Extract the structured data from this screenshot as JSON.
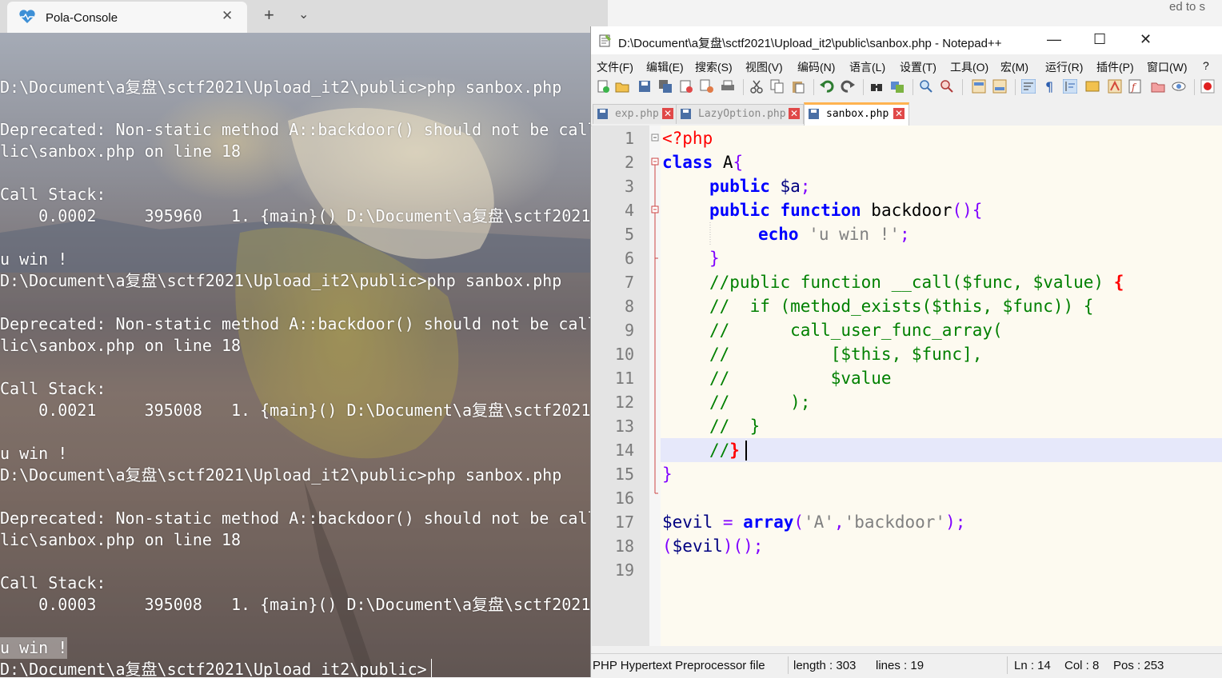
{
  "terminal": {
    "tab_title": "Pola-Console",
    "close_glyph": "✕",
    "new_tab_glyph": "+",
    "dropdown_glyph": "⌄",
    "lines": [
      "D:\\Document\\a复盘\\sctf2021\\Upload_it2\\public>php sanbox.php",
      "Deprecated: Non-static method A::backdoor() should not be call",
      "lic\\sanbox.php on line 18",
      "Call Stack:",
      "    0.0002     395960   1. {main}() D:\\Document\\a复盘\\sctf2021",
      "u win !",
      "D:\\Document\\a复盘\\sctf2021\\Upload_it2\\public>php sanbox.php",
      "Deprecated: Non-static method A::backdoor() should not be call",
      "lic\\sanbox.php on line 18",
      "Call Stack:",
      "    0.0021     395008   1. {main}() D:\\Document\\a复盘\\sctf2021",
      "u win !",
      "D:\\Document\\a复盘\\sctf2021\\Upload_it2\\public>php sanbox.php",
      "Deprecated: Non-static method A::backdoor() should not be call",
      "lic\\sanbox.php on line 18",
      "Call Stack:",
      "    0.0003     395008   1. {main}() D:\\Document\\a复盘\\sctf2021",
      "u win !",
      "D:\\Document\\a复盘\\sctf2021\\Upload_it2\\public>"
    ]
  },
  "notepad": {
    "title": "D:\\Document\\a复盘\\sctf2021\\Upload_it2\\public\\sanbox.php - Notepad++",
    "window_controls": {
      "minimize": "—",
      "maximize": "☐",
      "close": "✕"
    },
    "background_text": "ed to s",
    "menu": [
      "文件(F)",
      "编辑(E)",
      "搜索(S)",
      "视图(V)",
      "编码(N)",
      "语言(L)",
      "设置(T)",
      "工具(O)",
      "宏(M)",
      "运行(R)",
      "插件(P)",
      "窗口(W)",
      "?"
    ],
    "tabs": [
      {
        "label": "exp.php",
        "active": false
      },
      {
        "label": "LazyOption.php",
        "active": false
      },
      {
        "label": "sanbox.php",
        "active": true
      }
    ],
    "tab_close_glyph": "✕",
    "line_numbers": [
      "1",
      "2",
      "3",
      "4",
      "5",
      "6",
      "7",
      "8",
      "9",
      "10",
      "11",
      "12",
      "13",
      "14",
      "15",
      "16",
      "17",
      "18",
      "19"
    ],
    "code": {
      "l1": "<?php",
      "l2_kw": "class",
      "l2_name": " A",
      "l2_brace": "{",
      "l3_kw": "public",
      "l3_var": " $a",
      "l3_semi": ";",
      "l4_kw": "public function",
      "l4_name": " backdoor",
      "l4_paren": "(){",
      "l5_kw": "echo",
      "l5_str": " 'u win !'",
      "l5_semi": ";",
      "l6": "}",
      "l7_cm": "//public function __call($func, $value) ",
      "l7_brace": "{",
      "l8": "//  if (method_exists($this, $func)) {",
      "l9": "//      call_user_func_array(",
      "l10": "//          [$this, $func],",
      "l11": "//          $value",
      "l12": "//      );",
      "l13": "//  }",
      "l14_cm": "//",
      "l14_brace": "}",
      "l15": "}",
      "l17_var": "$evil",
      "l17_eq": " = ",
      "l17_kw": "array",
      "l17_p1": "(",
      "l17_s1": "'A'",
      "l17_comma": ",",
      "l17_s2": "'backdoor'",
      "l17_p2": ");",
      "l18_p1": "(",
      "l18_var": "$evil",
      "l18_p2": ")();"
    },
    "status": {
      "file_type": "PHP Hypertext Preprocessor file",
      "length": "length : 303",
      "lines": "lines : 19",
      "ln": "Ln : 14",
      "col": "Col : 8",
      "pos": "Pos : 253"
    }
  },
  "colors": {
    "keyword": "#0000ff",
    "comment": "#008000",
    "string": "#808080",
    "variable": "#000080",
    "operator": "#8000ff",
    "php_tag": "#ff0000",
    "editor_bg": "#fdfaf0",
    "caret_line": "#e6e8fa",
    "active_tab_accent": "#ffb350"
  }
}
